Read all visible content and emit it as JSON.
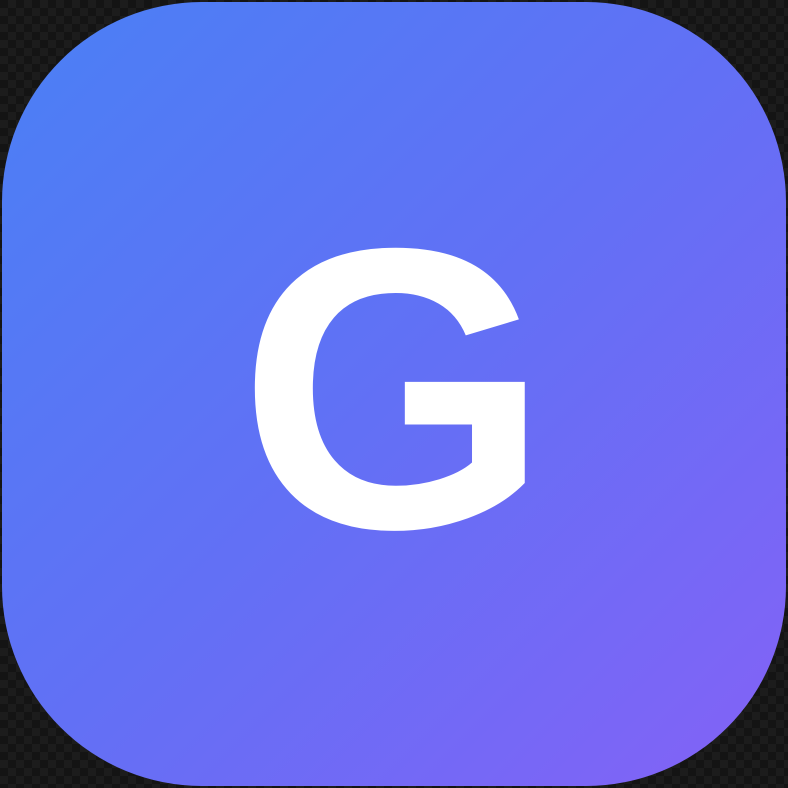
{
  "icon": {
    "letter": "G",
    "gradient_start": "#4a80f5",
    "gradient_mid": "#6270f5",
    "gradient_end": "#8462f6",
    "letter_color": "#ffffff"
  }
}
